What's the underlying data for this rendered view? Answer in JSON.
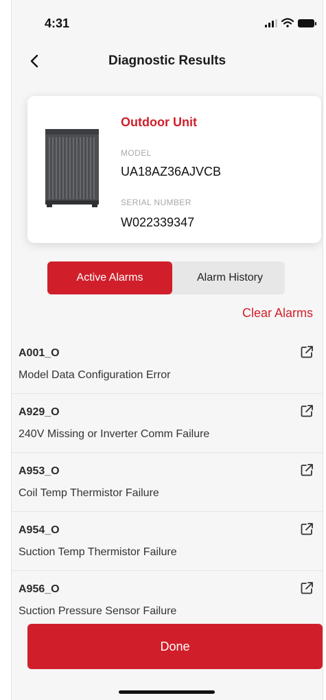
{
  "status_bar": {
    "time": "4:31"
  },
  "nav": {
    "title": "Diagnostic Results"
  },
  "unit": {
    "name": "Outdoor Unit",
    "model_label": "MODEL",
    "model": "UA18AZ36AJVCB",
    "serial_label": "SERIAL NUMBER",
    "serial": "W022339347"
  },
  "tabs": {
    "active_label": "Active Alarms",
    "history_label": "Alarm History",
    "selected": "Active Alarms"
  },
  "clear_label": "Clear Alarms",
  "alarms": [
    {
      "code": "A001_O",
      "description": "Model Data Configuration Error"
    },
    {
      "code": "A929_O",
      "description": "240V Missing or Inverter Comm Failure"
    },
    {
      "code": "A953_O",
      "description": "Coil Temp Thermistor Failure"
    },
    {
      "code": "A954_O",
      "description": "Suction Temp Thermistor Failure"
    },
    {
      "code": "A956_O",
      "description": "Suction Pressure Sensor Failure"
    }
  ],
  "done_label": "Done",
  "colors": {
    "accent": "#d01f2a",
    "background": "#f6f6f6"
  },
  "icons": [
    "back-chevron-icon",
    "signal-icon",
    "wifi-icon",
    "battery-icon",
    "external-link-icon"
  ]
}
